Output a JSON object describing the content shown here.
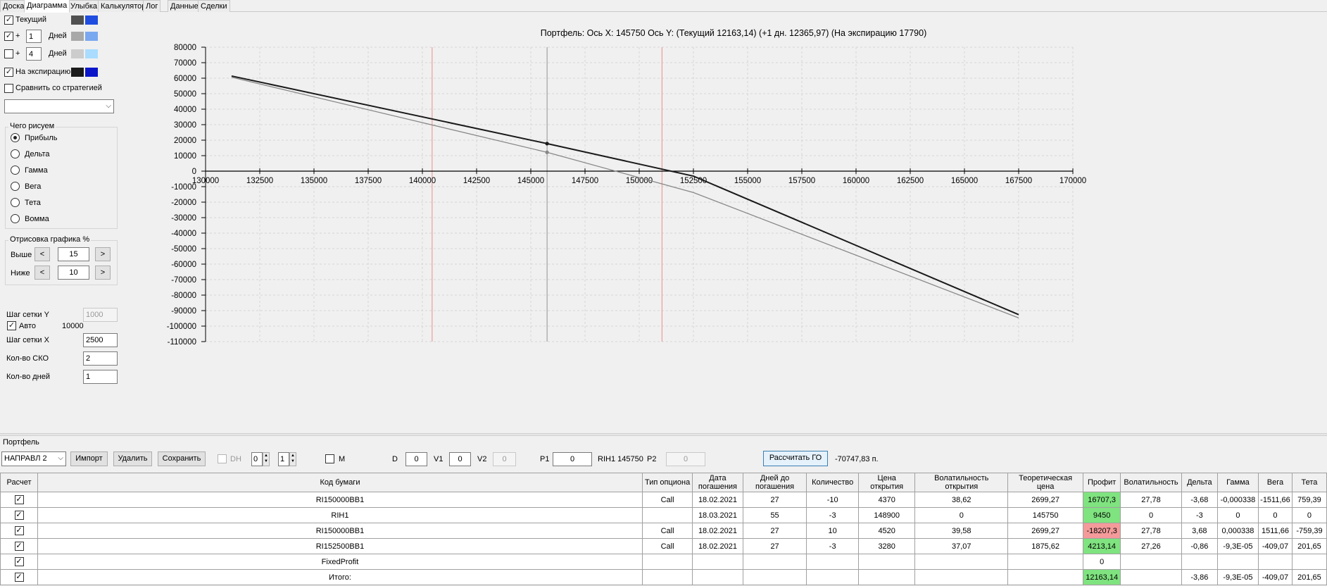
{
  "tabs": [
    "Доска",
    "Диаграмма",
    "Улыбка",
    "Калькулятор",
    "Лог",
    "Данные",
    "Сделки"
  ],
  "active_tab": "Диаграмма",
  "left": {
    "rows": [
      {
        "checked": true,
        "label": "Текущий",
        "color1": "#505050",
        "color2": "#1f4de0"
      },
      {
        "checked": true,
        "plus": "+",
        "days": "1",
        "days_label": "Дней",
        "color1": "#a8a8a8",
        "color2": "#7aa8f0"
      },
      {
        "checked": false,
        "plus": "+",
        "days": "4",
        "days_label": "Дней",
        "color1": "#cccccc",
        "color2": "#a9dcff"
      },
      {
        "checked": true,
        "label": "На экспирацию",
        "color1": "#1a1a1a",
        "color2": "#0b16c9"
      }
    ],
    "compare_label": "Сравнить со стратегией",
    "compare_checked": false,
    "strategy_combo": "",
    "draw_group_title": "Чего рисуем",
    "draw_options": [
      "Прибыль",
      "Дельта",
      "Гамма",
      "Вега",
      "Тета",
      "Вомма"
    ],
    "draw_selected": 0,
    "render_group_title": "Отрисовка графика %",
    "above_label": "Выше",
    "above_value": "15",
    "below_label": "Ниже",
    "below_value": "10",
    "prev_glyph": "<",
    "next_glyph": ">",
    "grid_y_label": "Шаг сетки Y",
    "grid_y_value": "1000",
    "auto_label": "Авто",
    "auto_checked": true,
    "auto_value": "10000",
    "grid_x_label": "Шаг сетки X",
    "grid_x_value": "2500",
    "sko_label": "Кол-во СКО",
    "sko_value": "2",
    "days_count_label": "Кол-во дней",
    "days_count_value": "1"
  },
  "chart_title": "Портфель: Ось X: 145750 Ось Y:  (Текущий 12163,14)  (+1 дн. 12365,97)  (На экспирацию 17790)",
  "chart_data": {
    "type": "line",
    "xlim": [
      130000,
      170000
    ],
    "ylim": [
      -110000,
      80000
    ],
    "x_ticks": [
      130000,
      132500,
      135000,
      137500,
      140000,
      142500,
      145000,
      147500,
      150000,
      152500,
      155000,
      157500,
      160000,
      162500,
      165000,
      167500,
      170000
    ],
    "y_ticks": [
      80000,
      70000,
      60000,
      50000,
      40000,
      30000,
      20000,
      10000,
      0,
      -10000,
      -20000,
      -30000,
      -40000,
      -50000,
      -60000,
      -70000,
      -80000,
      -90000,
      -100000,
      -110000
    ],
    "grid": true,
    "vlines": [
      {
        "x": 140450,
        "color": "#f08a8a"
      },
      {
        "x": 145750,
        "color": "#909090"
      },
      {
        "x": 151050,
        "color": "#f08a8a"
      }
    ],
    "series": [
      {
        "color": "#1a1a1a",
        "width": 2,
        "x": [
          131200,
          145750,
          152500,
          167500
        ],
        "y": [
          61400,
          17790,
          -3200,
          -92600
        ],
        "marker_x": 145750
      },
      {
        "color": "#888888",
        "width": 1.3,
        "x": [
          131200,
          145750,
          152500,
          167500
        ],
        "y": [
          60600,
          12163,
          -13800,
          -94700
        ],
        "marker_x": 145750
      }
    ]
  },
  "portfolio": {
    "section_label": "Портфель",
    "combo_value": "НАПРАВЛ 2",
    "import_btn": "Импорт",
    "delete_btn": "Удалить",
    "save_btn": "Сохранить",
    "dh_label": "DH",
    "spin1": "0",
    "spin2": "1",
    "m_label": "M",
    "d_label": "D",
    "d_value": "0",
    "v1_label": "V1",
    "v1_value": "0",
    "v2_label": "V2",
    "v2_value": "0",
    "p1_label": "P1",
    "p1_value": "0",
    "rih_label": "RIH1 145750",
    "p2_label": "P2",
    "p2_value": "0",
    "calc_btn": "Рассчитать ГО",
    "go_value": "-70747,83 п."
  },
  "table": {
    "headers": [
      "Расчет",
      "Код бумаги",
      "Тип опциона",
      "Дата погашения",
      "Дней до погашения",
      "Количество",
      "Цена открытия",
      "Волатильность открытия",
      "Теоретическая цена",
      "Профит",
      "Волатильность",
      "Дельта",
      "Гамма",
      "Вега",
      "Тета"
    ],
    "rows": [
      {
        "checked": true,
        "cells": [
          "RI150000BB1",
          "Call",
          "18.02.2021",
          "27",
          "-10",
          "4370",
          "38,62",
          "2699,27",
          "16707,3",
          "27,78",
          "-3,68",
          "-0,000338",
          "-1511,66",
          "759,39"
        ],
        "profit_state": "pos"
      },
      {
        "checked": true,
        "cells": [
          "RIH1",
          "",
          "18.03.2021",
          "55",
          "-3",
          "148900",
          "0",
          "145750",
          "9450",
          "0",
          "-3",
          "0",
          "0",
          "0"
        ],
        "profit_state": "pos"
      },
      {
        "checked": true,
        "cells": [
          "RI150000BB1",
          "Call",
          "18.02.2021",
          "27",
          "10",
          "4520",
          "39,58",
          "2699,27",
          "-18207,3",
          "27,78",
          "3,68",
          "0,000338",
          "1511,66",
          "-759,39"
        ],
        "profit_state": "neg"
      },
      {
        "checked": true,
        "cells": [
          "RI152500BB1",
          "Call",
          "18.02.2021",
          "27",
          "-3",
          "3280",
          "37,07",
          "1875,62",
          "4213,14",
          "27,26",
          "-0,86",
          "-9,3E-05",
          "-409,07",
          "201,65"
        ],
        "profit_state": "pos"
      },
      {
        "checked": true,
        "cells": [
          "FixedProfit",
          "",
          "",
          "",
          "",
          "",
          "",
          "",
          "0",
          "",
          "",
          "",
          "",
          ""
        ],
        "profit_state": "none"
      },
      {
        "checked": true,
        "cells": [
          "Итого:",
          "",
          "",
          "",
          "",
          "",
          "",
          "",
          "12163,14",
          "",
          "-3,86",
          "-9,3E-05",
          "-409,07",
          "201,65"
        ],
        "profit_state": "pos"
      }
    ]
  }
}
